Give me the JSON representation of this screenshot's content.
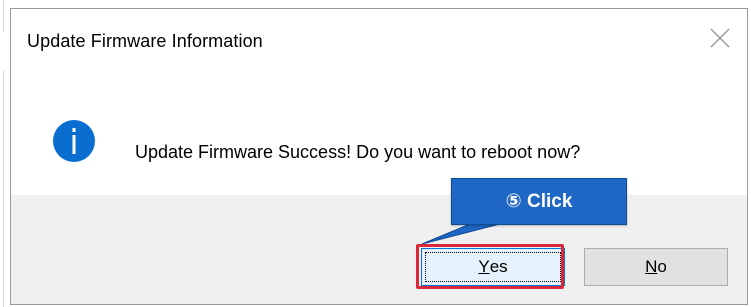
{
  "dialog": {
    "title": "Update Firmware Information",
    "close_icon": "close-icon",
    "message_icon": "info-icon",
    "message": "Update Firmware Success! Do you want to reboot now?",
    "buttons": {
      "yes": {
        "mnemonic": "Y",
        "rest": "es"
      },
      "no": {
        "mnemonic": "N",
        "rest": "o"
      }
    }
  },
  "annotation": {
    "callout_label": "⑤ Click",
    "callout_color": "#1e67c5",
    "highlight_color": "#d9283a"
  },
  "colors": {
    "info_icon": "#0a6ed1",
    "footer_bg": "#f0f0f0",
    "button_bg": "#e1e1e1"
  }
}
